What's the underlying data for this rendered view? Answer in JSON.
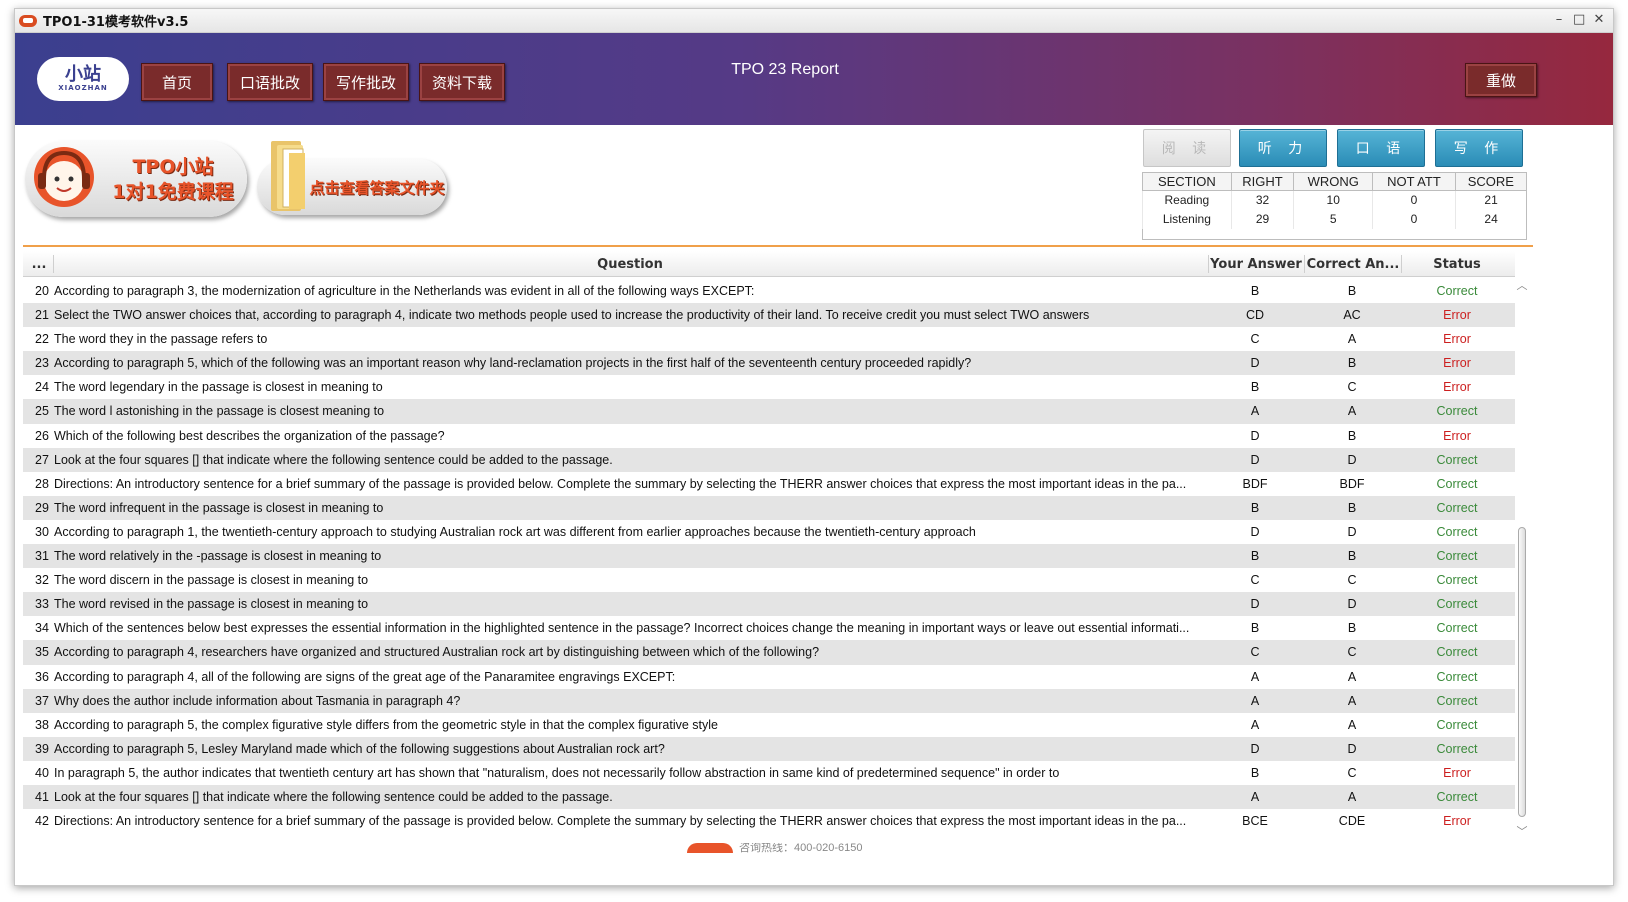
{
  "window": {
    "title": "TPO1-31模考软件v3.5",
    "controls": [
      "–",
      "□",
      "✕"
    ]
  },
  "header": {
    "logo_main": "小站",
    "logo_sub": "XIAOZHAN",
    "nav": [
      "首页",
      "口语批改",
      "写作批改",
      "资料下载"
    ],
    "report_title": "TPO 23 Report",
    "redo": "重做",
    "colors": {
      "gradient_start": "#3b3f8f",
      "gradient_end": "#96283e",
      "button": "#7a2b2b"
    }
  },
  "promos": {
    "course": [
      "TPO小站",
      "1对1免费课程"
    ],
    "answers": "点击查看答案文件夹"
  },
  "section_tabs": [
    {
      "label": "阅 读",
      "state": "disabled"
    },
    {
      "label": "听 力",
      "state": "active"
    },
    {
      "label": "口 语",
      "state": "active"
    },
    {
      "label": "写 作",
      "state": "active"
    }
  ],
  "score_table": {
    "headers": [
      "SECTION",
      "RIGHT",
      "WRONG",
      "NOT ATT",
      "SCORE"
    ],
    "rows": [
      [
        "Reading",
        "32",
        "10",
        "0",
        "21"
      ],
      [
        "Listening",
        "29",
        "5",
        "0",
        "24"
      ]
    ]
  },
  "question_table": {
    "headers": [
      "...",
      "Question",
      "Your Answer",
      "Correct An...",
      "Status"
    ],
    "rows": [
      {
        "num": "20",
        "question": "According to paragraph 3, the modernization of agriculture in the Netherlands was evident in all of the following ways EXCEPT:",
        "your": "B",
        "correct": "B",
        "status": "Correct"
      },
      {
        "num": "21",
        "question": "Select the TWO answer choices that, according to paragraph 4, indicate two methods people used to increase the productivity of their land. To receive credit you must select TWO answers",
        "your": "CD",
        "correct": "AC",
        "status": "Error"
      },
      {
        "num": "22",
        "question": "The word they in the passage refers to",
        "your": "C",
        "correct": "A",
        "status": "Error"
      },
      {
        "num": "23",
        "question": "According to paragraph 5, which of the following was an important reason why land-reclamation projects in the first half of the seventeenth century proceeded rapidly?",
        "your": "D",
        "correct": "B",
        "status": "Error"
      },
      {
        "num": "24",
        "question": "The word legendary in the passage is closest in meaning to",
        "your": "B",
        "correct": "C",
        "status": "Error"
      },
      {
        "num": "25",
        "question": "The word l astonishing in the passage is closest meaning to",
        "your": "A",
        "correct": "A",
        "status": "Correct"
      },
      {
        "num": "26",
        "question": "Which of the following best describes the organization of the passage?",
        "your": "D",
        "correct": "B",
        "status": "Error"
      },
      {
        "num": "27",
        "question": "Look at the four squares [] that indicate where the following sentence could be added to the passage.",
        "your": "D",
        "correct": "D",
        "status": "Correct"
      },
      {
        "num": "28",
        "question": "Directions: An introductory sentence for a brief summary of the passage is provided below. Complete the summary by selecting the THERR answer choices that express the most important ideas in the pa...",
        "your": "BDF",
        "correct": "BDF",
        "status": "Correct"
      },
      {
        "num": "29",
        "question": "The word infrequent in the passage is closest in meaning to",
        "your": "B",
        "correct": "B",
        "status": "Correct"
      },
      {
        "num": "30",
        "question": "According to paragraph 1, the twentieth-century approach to studying Australian rock art was different from earlier approaches because the twentieth-century approach",
        "your": "D",
        "correct": "D",
        "status": "Correct"
      },
      {
        "num": "31",
        "question": "The word  relatively in the -passage is closest in meaning to",
        "your": "B",
        "correct": "B",
        "status": "Correct"
      },
      {
        "num": "32",
        "question": "The word discern in the passage is closest in meaning to",
        "your": "C",
        "correct": "C",
        "status": "Correct"
      },
      {
        "num": "33",
        "question": "The word revised in the passage is closest in meaning to",
        "your": "D",
        "correct": "D",
        "status": "Correct"
      },
      {
        "num": "34",
        "question": "Which of the sentences below best expresses the essential information in the highlighted sentence in the passage? Incorrect choices change the meaning in important ways or leave out essential informati...",
        "your": "B",
        "correct": "B",
        "status": "Correct"
      },
      {
        "num": "35",
        "question": "According to paragraph 4, researchers have organized and structured Australian rock art by distinguishing between which of the following?",
        "your": "C",
        "correct": "C",
        "status": "Correct"
      },
      {
        "num": "36",
        "question": "According to paragraph 4, all of the following are signs of the great age of the Panaramitee engravings EXCEPT:",
        "your": "A",
        "correct": "A",
        "status": "Correct"
      },
      {
        "num": "37",
        "question": "Why does the author include information about Tasmania in paragraph 4?",
        "your": "A",
        "correct": "A",
        "status": "Correct"
      },
      {
        "num": "38",
        "question": "According to paragraph 5, the complex figurative style differs from the geometric style in that the complex figurative style",
        "your": "A",
        "correct": "A",
        "status": "Correct"
      },
      {
        "num": "39",
        "question": "According to paragraph 5, Lesley Maryland made which of the following suggestions about Australian rock art?",
        "your": "D",
        "correct": "D",
        "status": "Correct"
      },
      {
        "num": "40",
        "question": "In paragraph 5, the author indicates that twentieth century art has shown that \"naturalism, does not necessarily follow abstraction in same kind of predetermined sequence\" in order to",
        "your": "B",
        "correct": "C",
        "status": "Error"
      },
      {
        "num": "41",
        "question": "Look at the four squares [] that indicate where the following sentence could be added to the passage.",
        "your": "A",
        "correct": "A",
        "status": "Correct"
      },
      {
        "num": "42",
        "question": "Directions: An introductory sentence for a brief summary of the passage is provided below. Complete the summary by selecting the THERR answer choices that express the most important ideas in the pa...",
        "your": "BCE",
        "correct": "CDE",
        "status": "Error"
      }
    ],
    "colors": {
      "correct": "#3a8a3a",
      "error": "#cc1f1f",
      "stripe": "#e4e4e4"
    }
  },
  "footer": {
    "text": "咨询热线：400-020-6150"
  }
}
